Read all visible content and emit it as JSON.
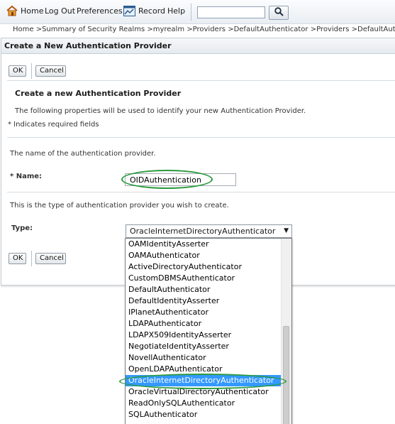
{
  "toolbar": {
    "home_label": "Home",
    "logout_label": "Log Out",
    "preferences_label": "Preferences",
    "record_label": "Record",
    "help_label": "Help",
    "search_value": ""
  },
  "breadcrumb": "Home >Summary of Security Realms >myrealm >Providers >DefaultAuthenticator >Providers >DefaultAuthenticator >Su",
  "panel": {
    "title": "Create a New Authentication Provider",
    "ok_label": "OK",
    "cancel_label": "Cancel",
    "section_title": "Create a new Authentication Provider",
    "intro": "The following properties will be used to identify your new Authentication Provider.",
    "required_note": "* Indicates required fields",
    "name_desc": "The name of the authentication provider.",
    "name_label": "* Name:",
    "name_value": "OIDAuthentication",
    "type_desc": "This is the type of authentication provider you wish to create.",
    "type_label": "Type:",
    "type_selected": "OracleInternetDirectoryAuthenticator"
  },
  "dropdown": {
    "options": [
      "OAMIdentityAsserter",
      "OAMAuthenticator",
      "ActiveDirectoryAuthenticator",
      "CustomDBMSAuthenticator",
      "DefaultAuthenticator",
      "DefaultIdentityAsserter",
      "IPlanetAuthenticator",
      "LDAPAuthenticator",
      "LDAPX509IdentityAsserter",
      "NegotiateIdentityAsserter",
      "NovellAuthenticator",
      "OpenLDAPAuthenticator",
      "OracleInternetDirectoryAuthenticator",
      "OracleVirtualDirectoryAuthenticator",
      "ReadOnlySQLAuthenticator",
      "SQLAuthenticator"
    ],
    "selected_index": 12
  },
  "colors": {
    "highlight_oval": "#2a9a3c",
    "selection": "#3399ff"
  },
  "icons": [
    "home-icon",
    "record-icon",
    "search-icon",
    "dropdown-arrow-icon"
  ]
}
